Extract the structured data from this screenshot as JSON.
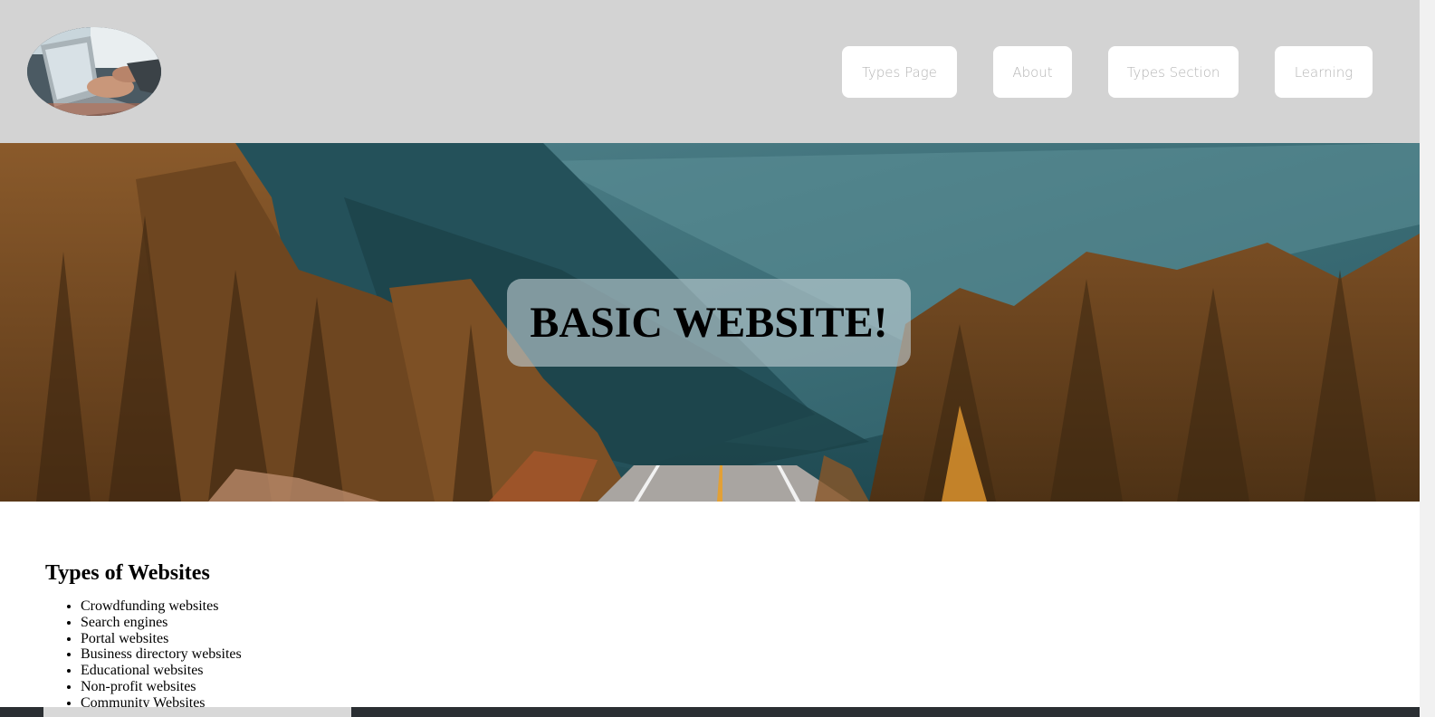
{
  "header": {
    "logo_icon": "laptop-typing-photo-icon",
    "nav": [
      {
        "label": "Types Page"
      },
      {
        "label": "About"
      },
      {
        "label": "Types Section"
      },
      {
        "label": "Learning"
      }
    ],
    "background": "#d3d3d3"
  },
  "hero": {
    "title": "BASIC WEBSITE!",
    "image": "mountain-forest-road-photo"
  },
  "main": {
    "heading": "Types of Websites",
    "items": [
      "Crowdfunding websites",
      "Search engines",
      "Portal websites",
      "Business directory websites",
      "Educational websites",
      "Non-profit websites",
      "Community Websites"
    ]
  }
}
